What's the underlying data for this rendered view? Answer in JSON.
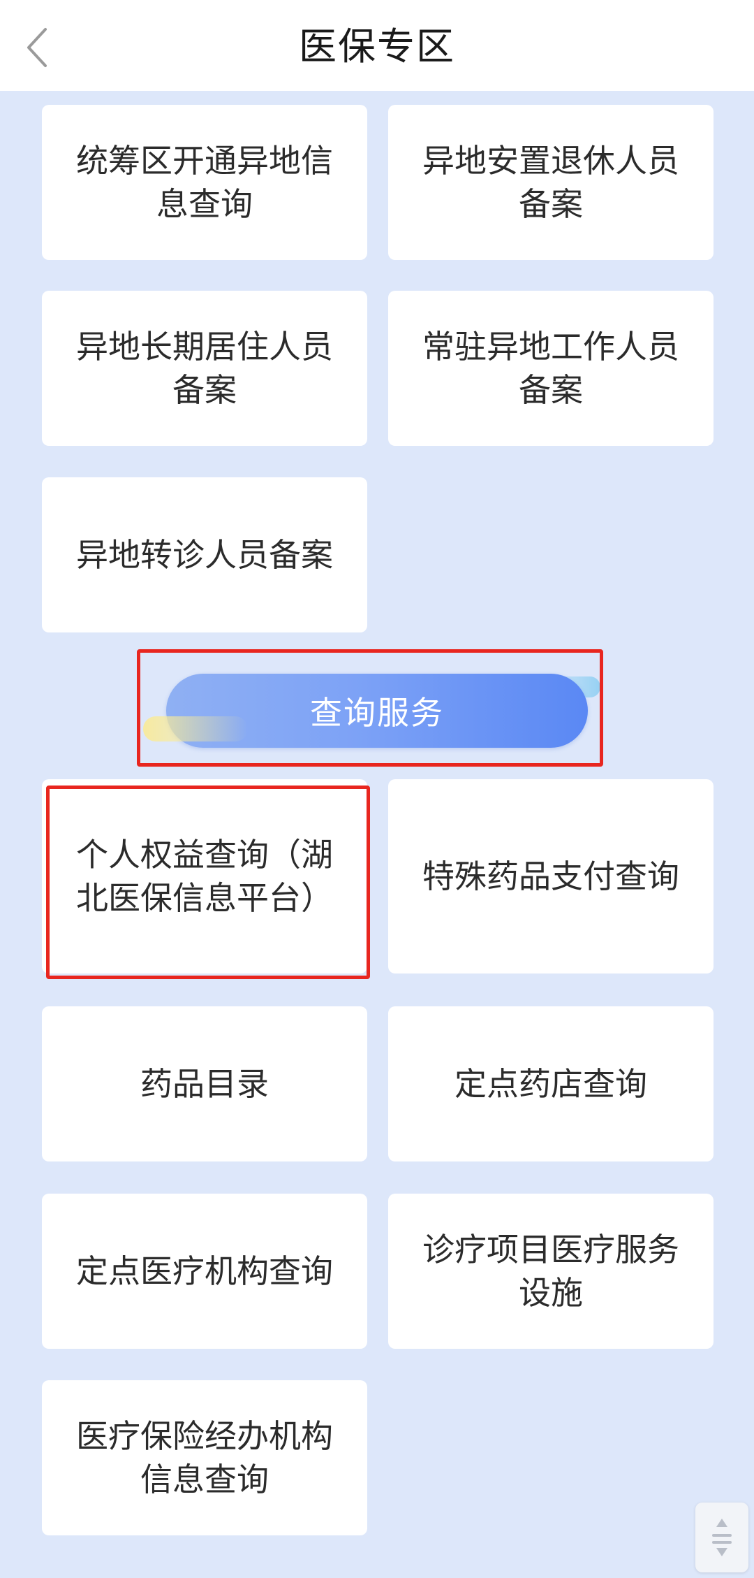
{
  "header": {
    "title": "医保专区"
  },
  "section_top": {
    "items": [
      {
        "label": "统筹区开通异地信息查询"
      },
      {
        "label": "异地安置退休人员备案"
      },
      {
        "label": "异地长期居住人员备案"
      },
      {
        "label": "常驻异地工作人员备案"
      },
      {
        "label": "异地转诊人员备案"
      }
    ]
  },
  "query_section": {
    "title": "查询服务",
    "items": [
      {
        "label": "个人权益查询（湖北医保信息平台）"
      },
      {
        "label": "特殊药品支付查询"
      },
      {
        "label": "药品目录"
      },
      {
        "label": "定点药店查询"
      },
      {
        "label": "定点医疗机构查询"
      },
      {
        "label": "诊疗项目医疗服务设施"
      },
      {
        "label": "医疗保险经办机构信息查询"
      }
    ]
  },
  "colors": {
    "background": "#dde7fa",
    "card": "#ffffff",
    "highlight": "#e8261f",
    "pill_gradient_start": "#8fb0f3",
    "pill_gradient_end": "#5a88f4"
  },
  "icons": {
    "back": "chevron-left-icon",
    "scroll_top": "scroll-top-icon"
  }
}
